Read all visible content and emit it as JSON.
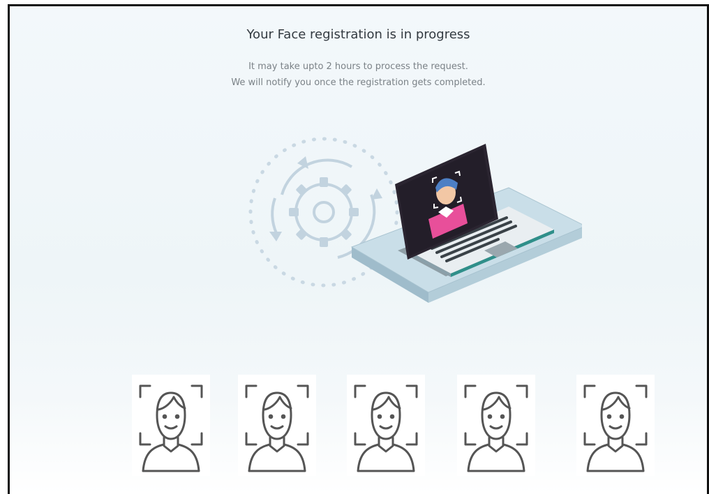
{
  "status": {
    "title": "Your Face registration is in progress",
    "line1": "It may take upto 2 hours to process the request.",
    "line2": "We will notify you once the registration gets completed."
  },
  "illustration": {
    "icon": "laptop-face-scan-illustration",
    "accent": "#e84f9a",
    "platform_color": "#b9d3df",
    "platform_edge": "#4b3f9e"
  },
  "face_icons": [
    {
      "icon": "face-scan-icon"
    },
    {
      "icon": "face-scan-icon"
    },
    {
      "icon": "face-scan-icon"
    },
    {
      "icon": "face-scan-icon"
    },
    {
      "icon": "face-scan-icon"
    }
  ]
}
